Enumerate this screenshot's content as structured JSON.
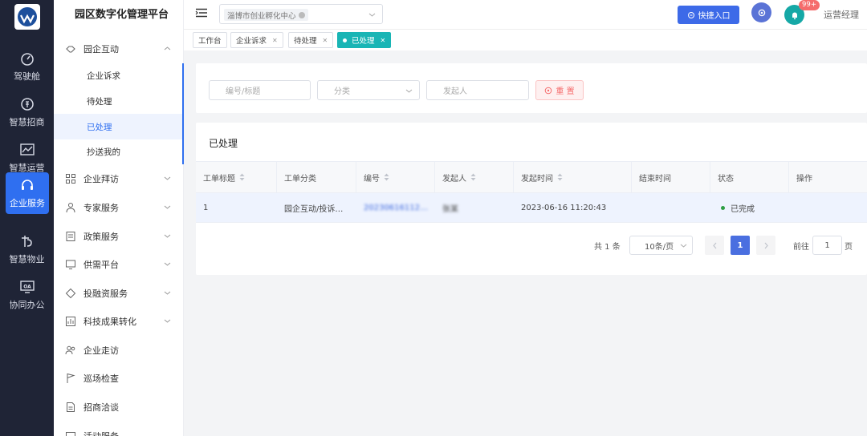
{
  "app": {
    "title": "园区数字化管理平台"
  },
  "rail": [
    {
      "label": "驾驶舱",
      "icon": "dashboard-icon"
    },
    {
      "label": "智慧招商",
      "icon": "money-icon"
    },
    {
      "label": "智慧运营",
      "icon": "trend-icon"
    },
    {
      "label": "企业服务",
      "icon": "headset-icon",
      "active": true
    },
    {
      "label": "智慧物业",
      "icon": "building-icon"
    },
    {
      "label": "协同办公",
      "icon": "oa-icon"
    }
  ],
  "menu": {
    "group_park": "园企互动",
    "sub_items": [
      "企业诉求",
      "待处理",
      "已处理",
      "抄送我的"
    ],
    "groups": [
      "企业拜访",
      "专家服务",
      "政策服务",
      "供需平台",
      "投融资服务",
      "科技成果转化",
      "企业走访",
      "巡场检查",
      "招商洽谈",
      "活动服务"
    ]
  },
  "header": {
    "org_tag": "淄博市创业孵化中心",
    "quick_entry": "快捷入口",
    "badge": "99+",
    "user": "运营经理"
  },
  "tabs": [
    "工作台",
    "企业诉求",
    "待处理",
    "已处理"
  ],
  "filter": {
    "code_placeholder": "编号/标题",
    "category_placeholder": "分类",
    "initiator_placeholder": "发起人",
    "reset": "重 置"
  },
  "table": {
    "title": "已处理",
    "columns": [
      "工单标题",
      "工单分类",
      "编号",
      "发起人",
      "发起时间",
      "结束时间",
      "状态",
      "操作"
    ],
    "rows": [
      {
        "title": "1",
        "category": "园企互动/投诉…",
        "code": "20230616112…",
        "initiator": "张某",
        "start": "2023-06-16 11:20:43",
        "end": "",
        "status": "已完成"
      }
    ]
  },
  "pager": {
    "total": "共 1 条",
    "size": "10条/页",
    "current": "1",
    "goto_label": "前往",
    "goto_value": "1",
    "page_label": "页"
  },
  "colors": {
    "primary": "#2f6ff0",
    "teal": "#19b5b5",
    "danger": "#f56c6c",
    "rail": "#1f2436"
  }
}
